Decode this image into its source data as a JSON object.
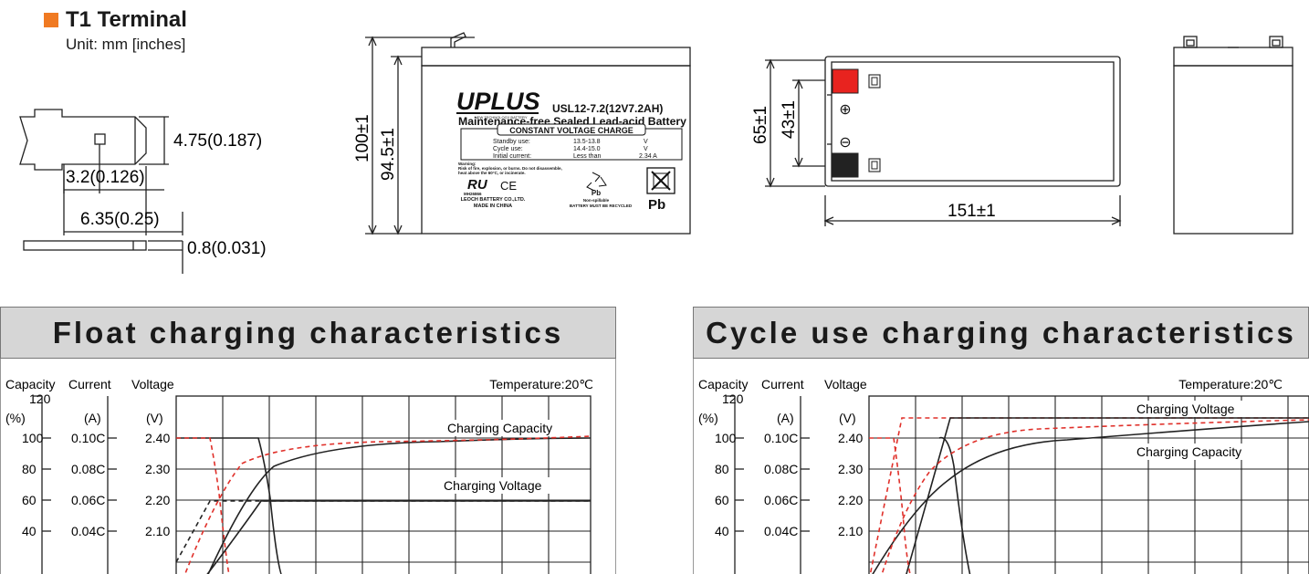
{
  "header": {
    "bullet_color": "#f07a22",
    "title": "T1 Terminal",
    "unit": "Unit: mm [inches]"
  },
  "terminal": {
    "dim_width": "4.75(0.187)",
    "dim_hole": "3.2(0.126)",
    "dim_length": "6.35(0.25)",
    "dim_thickness": "0.8(0.031)"
  },
  "front_view": {
    "dim_height": "100±1",
    "dim_body_height": "94.5±1",
    "brand": "UPLUS",
    "brand_tagline": "NEW TECHNOLOGY BATTERY",
    "model": "USL12-7.2(12V7.2AH)",
    "subtitle": "Maintenance-free Sealed Lead-acid Battery",
    "cvc_title": "CONSTANT VOLTAGE CHARGE",
    "cvc_rows": [
      {
        "label": "Standby   use:",
        "value": "13.5-13.8",
        "unit": "V"
      },
      {
        "label": "Cycle       use:",
        "value": "14.4-15.0",
        "unit": "V"
      },
      {
        "label": "Initial   current:",
        "value": "Less than",
        "unit": "2.34 A"
      }
    ],
    "warning": "Warning:",
    "warning_line1": "Risk of fire, explosion, or burns. Do not disassemble,",
    "warning_line2": "heat above the 60°C, or incinerate.",
    "ul_mark": "RU",
    "ul_number": "MH26866",
    "ce_mark": "CE",
    "maker_line1": "LEOCH BATTERY CO.,LTD.",
    "maker_line2": "MADE IN CHINA",
    "pb_label": "Pb",
    "nonspill_line1": "Non-spillable",
    "nonspill_line2": "BATTERY MUST BE RECYCLED",
    "pb_badge": "Pb"
  },
  "top_view": {
    "dim_width": "65±1",
    "dim_terminal_gap": "43±1",
    "dim_length": "151±1",
    "positive_color": "#e8231f",
    "negative_color": "#222222",
    "positive_symbol": "⊕",
    "negative_symbol": "⊖"
  },
  "charts": [
    {
      "title": "Float charging characteristics",
      "hdr_capacity": "Capacity",
      "hdr_current": "Current",
      "hdr_voltage": "Voltage",
      "temperature": "Temperature:20℃",
      "cap_unit": "(%)",
      "cur_unit": "(A)",
      "volt_unit": "(V)",
      "cap_top_tick": "120",
      "cap_ticks": [
        "100",
        "80",
        "60",
        "40"
      ],
      "cur_ticks": [
        "0.10C",
        "0.08C",
        "0.06C",
        "0.04C"
      ],
      "volt_ticks": [
        "2.40",
        "2.30",
        "2.20",
        "2.10"
      ],
      "annotations": [
        "Charging Capacity",
        "Charging Voltage"
      ]
    },
    {
      "title": "Cycle use charging characteristics",
      "hdr_capacity": "Capacity",
      "hdr_current": "Current",
      "hdr_voltage": "Voltage",
      "temperature": "Temperature:20℃",
      "cap_unit": "(%)",
      "cur_unit": "(A)",
      "volt_unit": "(V)",
      "cap_top_tick": "120",
      "cap_ticks": [
        "100",
        "80",
        "60",
        "40"
      ],
      "cur_ticks": [
        "0.10C",
        "0.08C",
        "0.06C",
        "0.04C"
      ],
      "volt_ticks": [
        "2.40",
        "2.30",
        "2.20",
        "2.10"
      ],
      "annotations": [
        "Charging Voltage",
        "Charging Capacity"
      ]
    }
  ],
  "colors": {
    "accent": "#f07a22",
    "title_bar": "#d6d6d6",
    "curve": "#222222",
    "curve_dashed_red": "#e0302a",
    "curve_dashed_black": "#222222"
  }
}
